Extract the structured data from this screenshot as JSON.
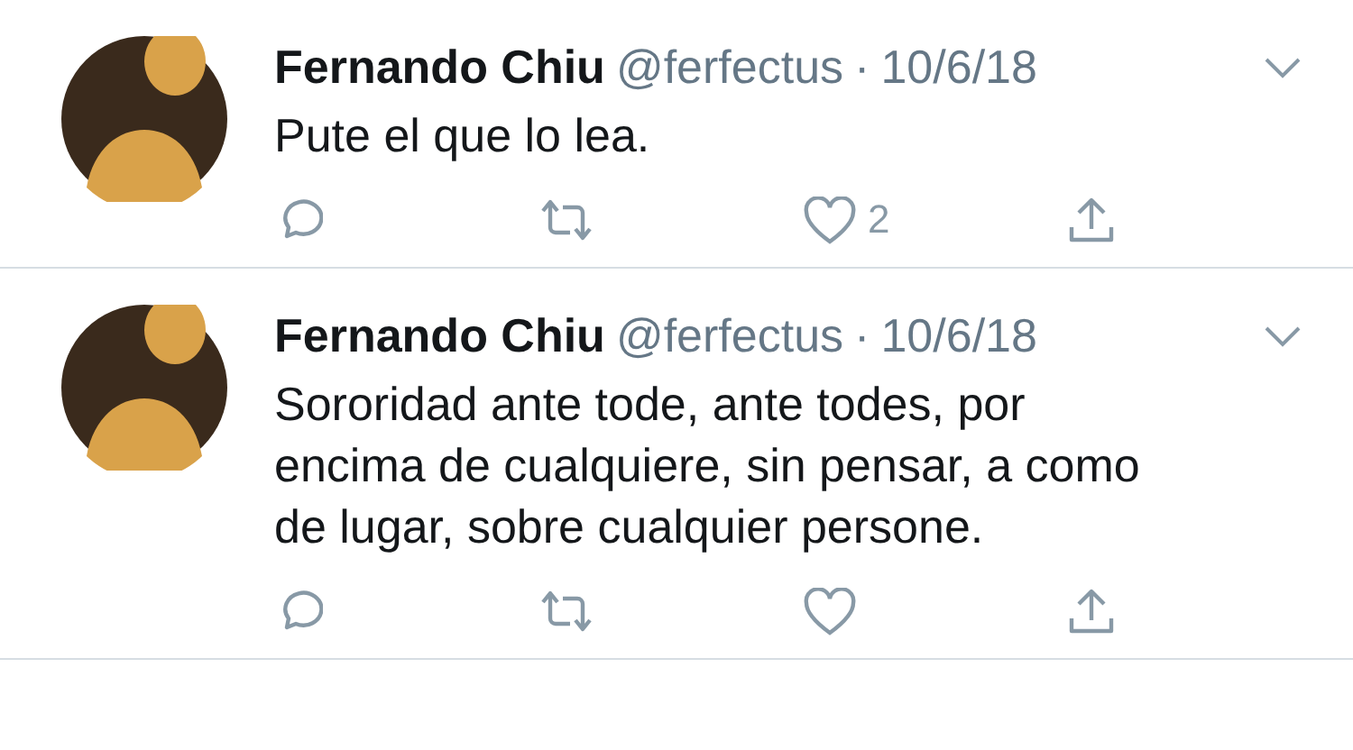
{
  "tweets": [
    {
      "name": "Fernando Chiu",
      "handle": "@ferfectus",
      "separator": "·",
      "date": "10/6/18",
      "lines": [
        "Pute el que lo lea."
      ],
      "likes": "2",
      "liked": false
    },
    {
      "name": "Fernando Chiu",
      "handle": "@ferfectus",
      "separator": "·",
      "date": "10/6/18",
      "lines": [
        "Sororidad ante tode, ante todes, por",
        "encima de cualquiere, sin pensar, a como",
        "de lugar, sobre cualquier persone."
      ],
      "liked": false
    }
  ]
}
